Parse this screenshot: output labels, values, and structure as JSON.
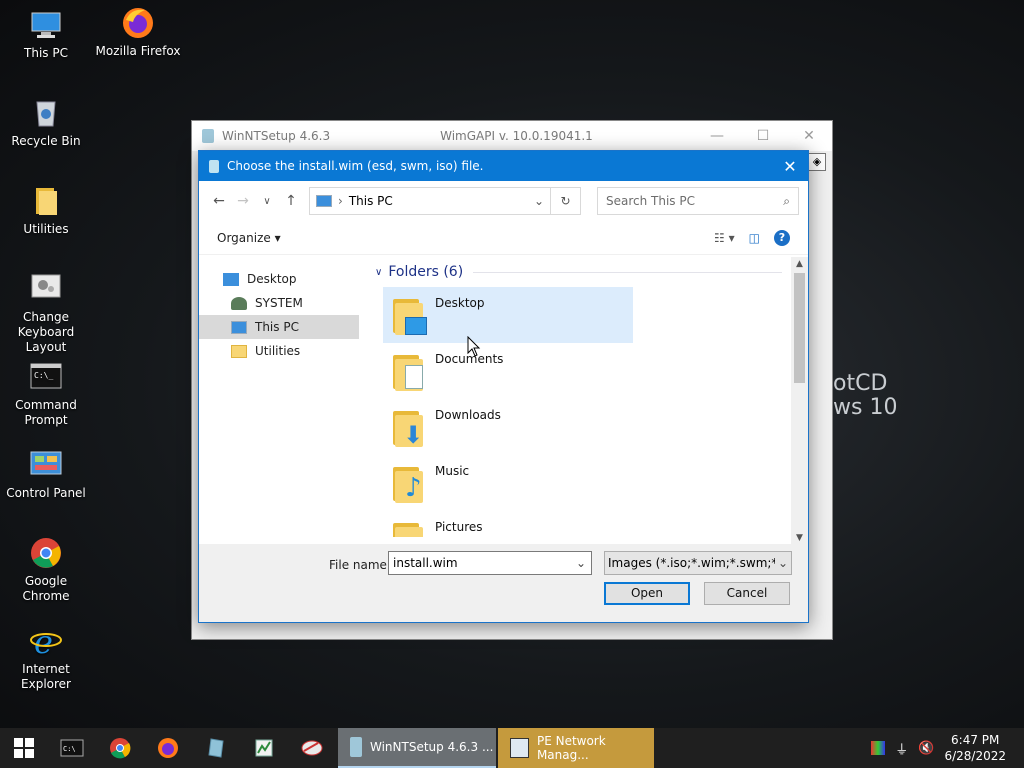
{
  "desktop": {
    "icons": [
      {
        "label": "This PC"
      },
      {
        "label": "Mozilla Firefox"
      },
      {
        "label": "Recycle Bin"
      },
      {
        "label": "Utilities"
      },
      {
        "label": "Change Keyboard Layout"
      },
      {
        "label": "Command Prompt"
      },
      {
        "label": "Control Panel"
      },
      {
        "label": "Google Chrome"
      },
      {
        "label": "Internet Explorer"
      }
    ],
    "background_text": [
      "otCD",
      "ws 10"
    ]
  },
  "main_window": {
    "title": "WinNTSetup 4.6.3",
    "subtitle": "WimGAPI v. 10.0.19041.1"
  },
  "dialog": {
    "title": "Choose the install.wim (esd, swm, iso) file.",
    "address": "This PC",
    "search_placeholder": "Search This PC",
    "organize_label": "Organize",
    "nav_items": [
      {
        "label": "Desktop"
      },
      {
        "label": "SYSTEM"
      },
      {
        "label": "This PC"
      },
      {
        "label": "Utilities"
      }
    ],
    "group_header": "Folders (6)",
    "folders": [
      {
        "name": "Desktop"
      },
      {
        "name": "Documents"
      },
      {
        "name": "Downloads"
      },
      {
        "name": "Music"
      },
      {
        "name": "Pictures"
      }
    ],
    "file_name_label": "File name:",
    "file_name_value": "install.wim",
    "filter_value": "Images (*.iso;*.wim;*.swm;*.esd",
    "open_label": "Open",
    "cancel_label": "Cancel"
  },
  "taskbar": {
    "tasks": [
      {
        "label": "WinNTSetup 4.6.3  ..."
      },
      {
        "label": "PE Network Manag..."
      }
    ],
    "time": "6:47 PM",
    "date": "6/28/2022"
  },
  "colors": {
    "dialog_title": "#0a78d4",
    "selection": "#dcecfc",
    "taskbar": "#1f1f1f"
  }
}
